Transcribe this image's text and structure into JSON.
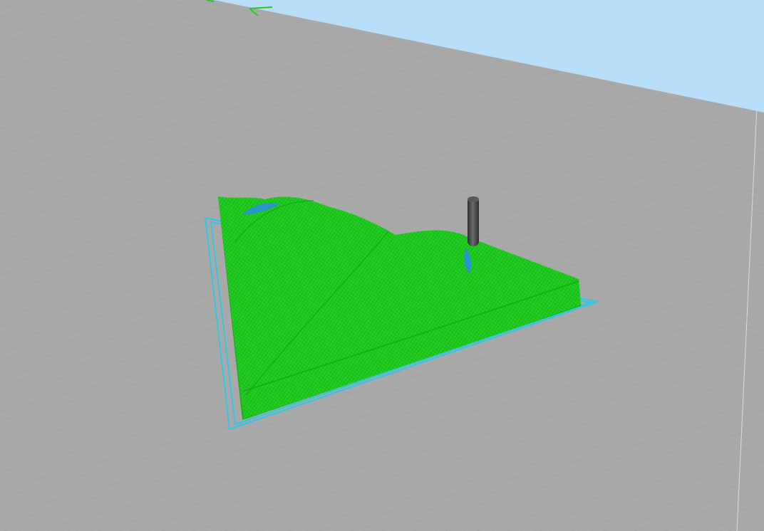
{
  "viewport": {
    "view": "3d-toolpath-preview",
    "colors": {
      "sky": "#b9defa",
      "bed": "#a9a9a9",
      "grid_major": "#8a8a8a",
      "grid_minor": "#9c9c9c",
      "toolpath": "#1fd21f",
      "toolpath_shade": "#14b014",
      "boundary": "#2ec7e6",
      "tool": "#4a4a4a"
    },
    "icons": [
      "axis-gizmo-icon",
      "cutting-tool-icon"
    ]
  }
}
